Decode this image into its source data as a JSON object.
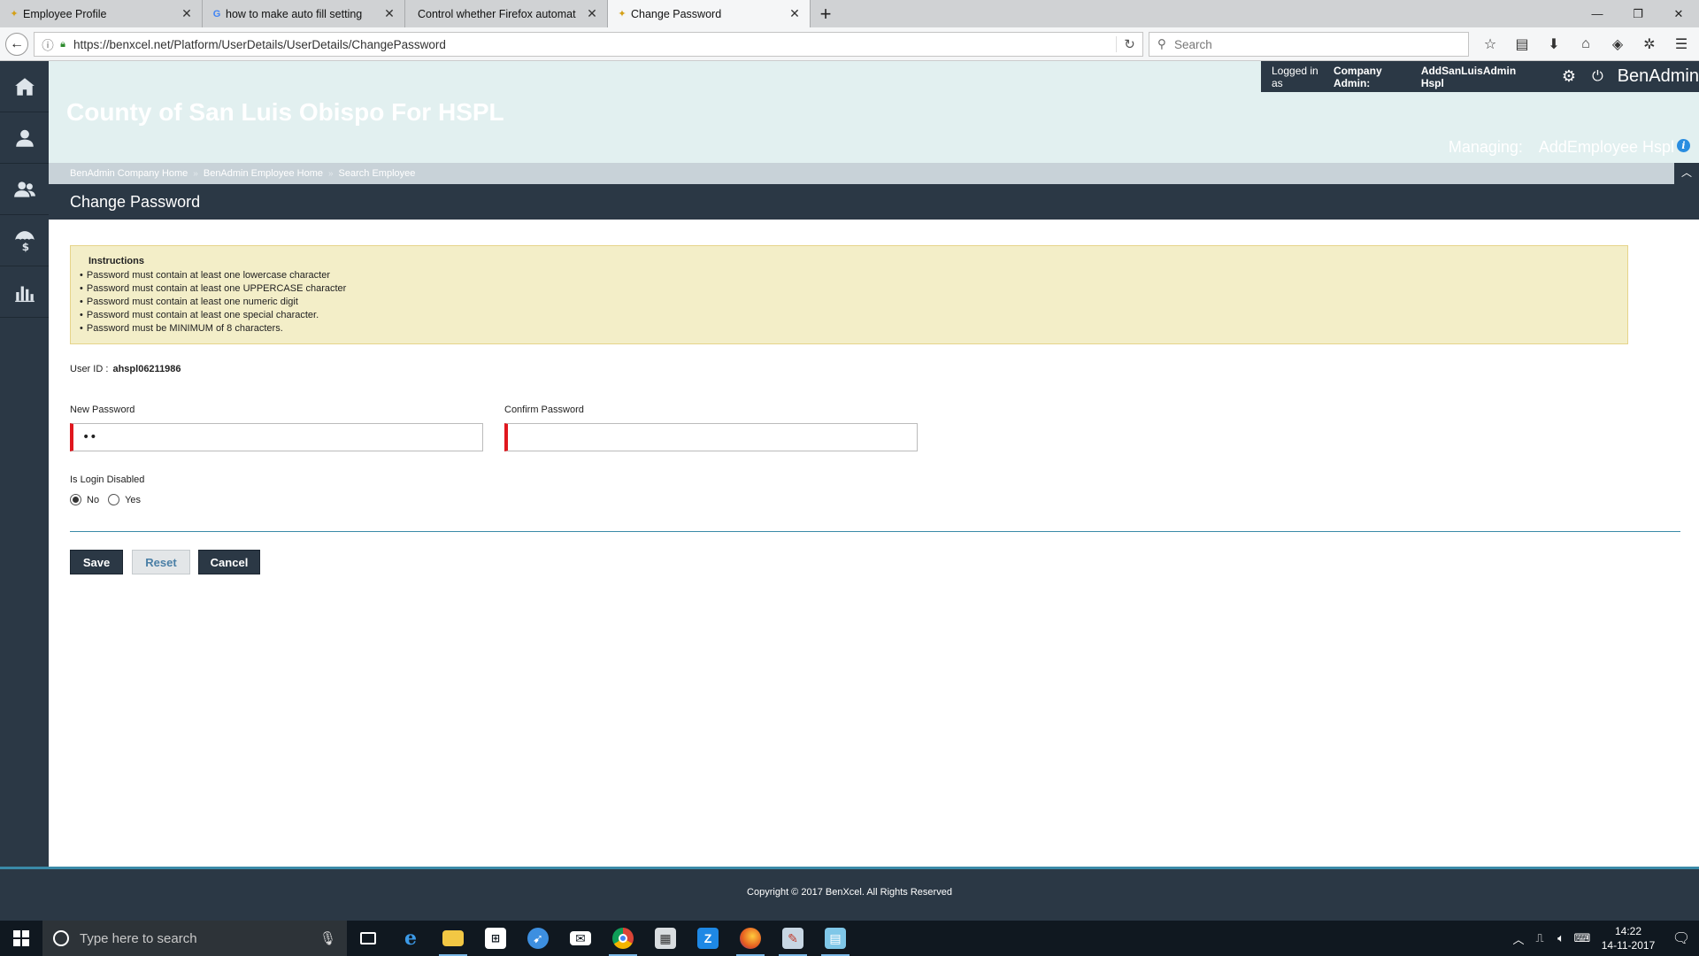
{
  "browser": {
    "tabs": [
      {
        "title": "Employee Profile",
        "active": false,
        "favicon": "benxcel-icon"
      },
      {
        "title": "how to make auto fill setting",
        "active": false,
        "favicon": "google-icon"
      },
      {
        "title": "Control whether Firefox automat",
        "active": false,
        "favicon": "none"
      },
      {
        "title": "Change Password",
        "active": true,
        "favicon": "benxcel-icon"
      }
    ],
    "url": "https://benxcel.net/Platform/UserDetails/UserDetails/ChangePassword",
    "search_placeholder": "Search"
  },
  "header": {
    "company_name": "County of San Luis Obispo For HSPL",
    "logged_in_prefix": "Logged in as",
    "role": "Company Admin:",
    "user": "AddSanLuisAdmin Hspl",
    "brand": "BenAdmin",
    "managing_label": "Managing:",
    "managing_value": "AddEmployee Hspl",
    "info_glyph": "i"
  },
  "breadcrumb": [
    "BenAdmin Company Home",
    "BenAdmin Employee Home",
    "Search Employee"
  ],
  "breadcrumb_separator": "»",
  "page_title": "Change Password",
  "instructions": {
    "title": "Instructions",
    "items": [
      "Password must contain at least one lowercase character",
      "Password must contain at least one UPPERCASE character",
      "Password must contain at least one numeric digit",
      "Password must contain at least one special character.",
      "Password must be MINIMUM of 8 characters."
    ]
  },
  "form": {
    "user_id_label": "User ID :",
    "user_id_value": "ahspl06211986",
    "new_password_label": "New Password",
    "new_password_value": "••",
    "confirm_password_label": "Confirm Password",
    "confirm_password_value": "",
    "login_disabled_label": "Is Login Disabled",
    "radio_no": "No",
    "radio_yes": "Yes",
    "selected": "No"
  },
  "buttons": {
    "save": "Save",
    "reset": "Reset",
    "cancel": "Cancel"
  },
  "footer": {
    "copyright": "Copyright © 2017 BenXcel. All Rights Reserved"
  },
  "taskbar": {
    "search_placeholder": "Type here to search",
    "time": "14:22",
    "date": "14-11-2017"
  },
  "colors": {
    "navy": "#2b3845",
    "header_bg": "#e2f0f0",
    "instructions_bg": "#f3eec8",
    "required_red": "#e0171e",
    "accent_teal": "#3a8aa8"
  }
}
